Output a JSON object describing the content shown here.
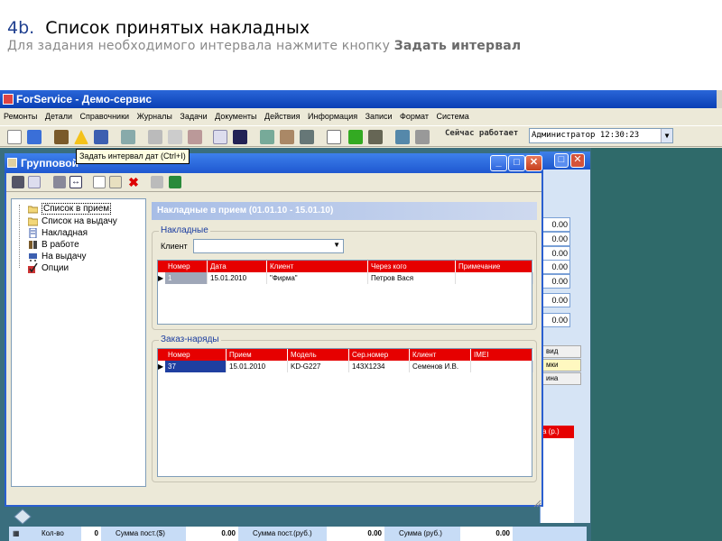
{
  "slide": {
    "number": "4b.",
    "title": "Список принятых накладных",
    "subtitle_prefix": "Для задания необходимого интервала нажмите кнопку ",
    "subtitle_bold": "Задать интервал"
  },
  "app": {
    "title": "ForService - Демо-сервис",
    "menu": [
      "Ремонты",
      "Детали",
      "Справочники",
      "Журналы",
      "Задачи",
      "Документы",
      "Действия",
      "Информация",
      "Записи",
      "Формат",
      "Система"
    ],
    "now_label": "Сейчас работает",
    "now_value": "Администратор 12:30:23"
  },
  "group_window": {
    "title": "Групповой",
    "tooltip": "Задать интервал дат (Ctrl+I)",
    "tree": [
      {
        "label": "Список в прием",
        "icon": "folder-open-icon",
        "selected": true
      },
      {
        "label": "Список на выдачу",
        "icon": "folder-icon",
        "selected": false
      },
      {
        "label": "Накладная",
        "icon": "document-icon",
        "selected": false
      },
      {
        "label": "В работе",
        "icon": "tools-icon",
        "selected": false
      },
      {
        "label": "На выдачу",
        "icon": "cart-icon",
        "selected": false
      },
      {
        "label": "Опции",
        "icon": "check-icon",
        "selected": false
      }
    ],
    "panel_header": "Накладные в прием (01.01.10 - 15.01.10)",
    "invoices": {
      "group_title": "Накладные",
      "client_label": "Клиент",
      "client_value": "",
      "columns": [
        "Номер",
        "Дата",
        "Клиент",
        "Через кого",
        "Примечание"
      ],
      "rows": [
        [
          "1",
          "15.01.2010",
          "\"Фирма\"",
          "Петров Вася",
          ""
        ]
      ]
    },
    "orders": {
      "group_title": "Заказ-наряды",
      "columns": [
        "Номер",
        "Прием",
        "Модель",
        "Сер.номер",
        "Клиент",
        "IMEI"
      ],
      "rows": [
        [
          "37",
          "15.01.2010",
          "KD-G227",
          "143X1234",
          "Семенов И.В.",
          ""
        ]
      ]
    }
  },
  "background": {
    "values": [
      "0.00",
      "0.00",
      "0.00",
      "0.00",
      "0.00",
      "0.00",
      "0.00"
    ],
    "tabs": [
      "вид",
      "мки",
      "ина"
    ],
    "red_label": "а (р.)",
    "bottom": {
      "qty_label": "Кол-во",
      "qty_value": "0",
      "sum_usd_label": "Сумма пост.($)",
      "sum_usd_value": "0.00",
      "sum_rub_label": "Сумма пост.(руб.)",
      "sum_rub_value": "0.00",
      "sum_label": "Сумма (руб.)",
      "sum_value": "0.00"
    }
  },
  "colors": {
    "grid_header": "#e60000",
    "titlebar": "#1f58d0",
    "workspace": "#3a6e7e"
  }
}
